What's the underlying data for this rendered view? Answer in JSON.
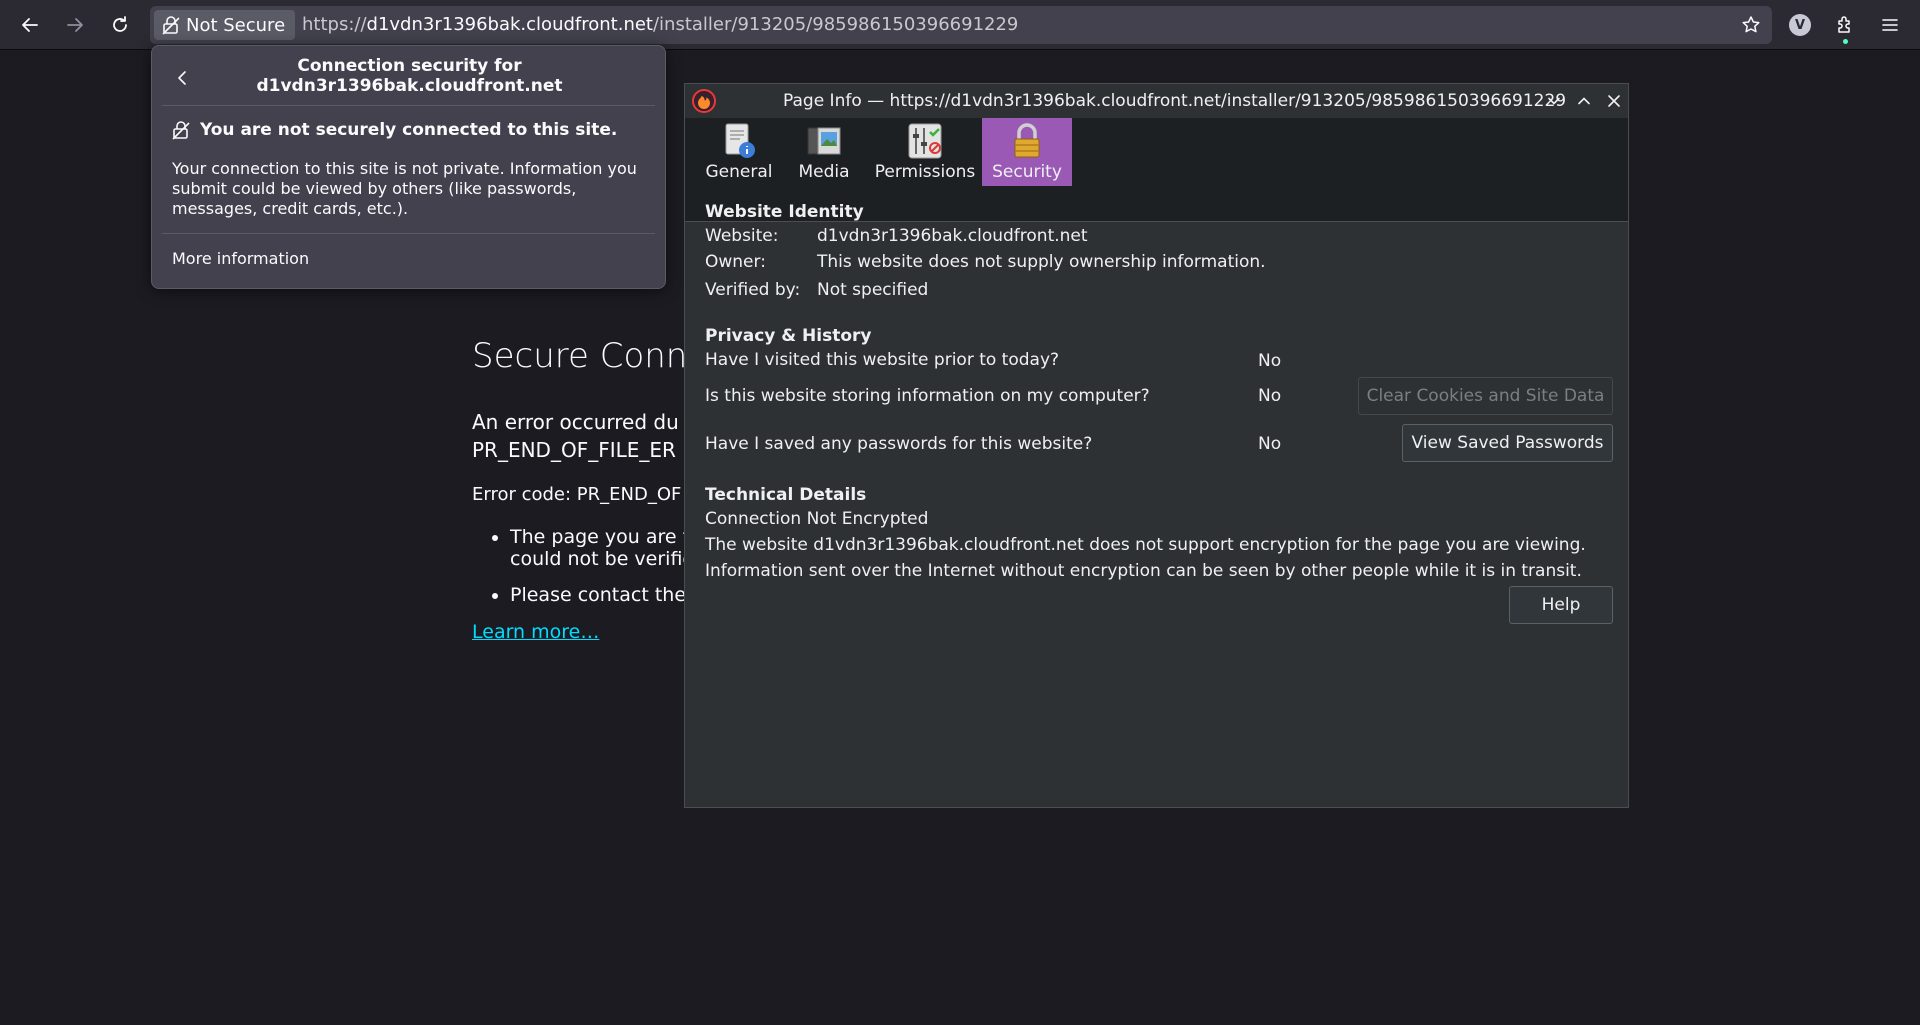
{
  "toolbar": {
    "identity_label": "Not Secure",
    "url_scheme": "https://",
    "url_host": "d1vdn3r1396bak.cloudfront.net",
    "url_path": "/installer/913205/985986150396691229",
    "avatar_letter": "V"
  },
  "error_page": {
    "title": "Secure Conne",
    "description": "An error occurred du PR_END_OF_FILE_ER",
    "code": "Error code: PR_END_OF",
    "bullets": [
      "The page you are t could not be verifie",
      "Please contact the"
    ],
    "learn_more": "Learn more…"
  },
  "popup": {
    "heading_line1": "Connection security for",
    "heading_line2": "d1vdn3r1396bak.cloudfront.net",
    "not_secure": "You are not securely connected to this site.",
    "body": "Your connection to this site is not private. Information you submit could be viewed by others (like passwords, messages, credit cards, etc.).",
    "more_info": "More information"
  },
  "dialog": {
    "title": "Page Info — https://d1vdn3r1396bak.cloudfront.net/installer/913205/985986150396691229",
    "tabs": [
      {
        "label": "General",
        "active": false
      },
      {
        "label": "Media",
        "active": false
      },
      {
        "label": "Permissions",
        "active": false
      },
      {
        "label": "Security",
        "active": true
      }
    ],
    "identity": {
      "heading": "Website Identity",
      "website_label": "Website:",
      "website_value": "d1vdn3r1396bak.cloudfront.net",
      "owner_label": "Owner:",
      "owner_value": "This website does not supply ownership information.",
      "verified_label": "Verified by:",
      "verified_value": "Not specified"
    },
    "privacy": {
      "heading": "Privacy & History",
      "q1": "Have I visited this website prior to today?",
      "a1": "No",
      "q2": "Is this website storing information on my computer?",
      "a2": "No",
      "clear_button": "Clear Cookies and Site Data",
      "q3": "Have I saved any passwords for this website?",
      "a3": "No",
      "passwords_button": "View Saved Passwords"
    },
    "technical": {
      "heading": "Technical Details",
      "line1": "Connection Not Encrypted",
      "line2": "The website d1vdn3r1396bak.cloudfront.net does not support encryption for the page you are viewing.",
      "line3": "Information sent over the Internet without encryption can be seen by other people while it is in transit."
    },
    "help_button": "Help"
  },
  "colors": {
    "accent_tab": "#9b59b6",
    "link": "#00ddff",
    "toolbar": "#2b2a33",
    "page_bg": "#1c1b22"
  }
}
